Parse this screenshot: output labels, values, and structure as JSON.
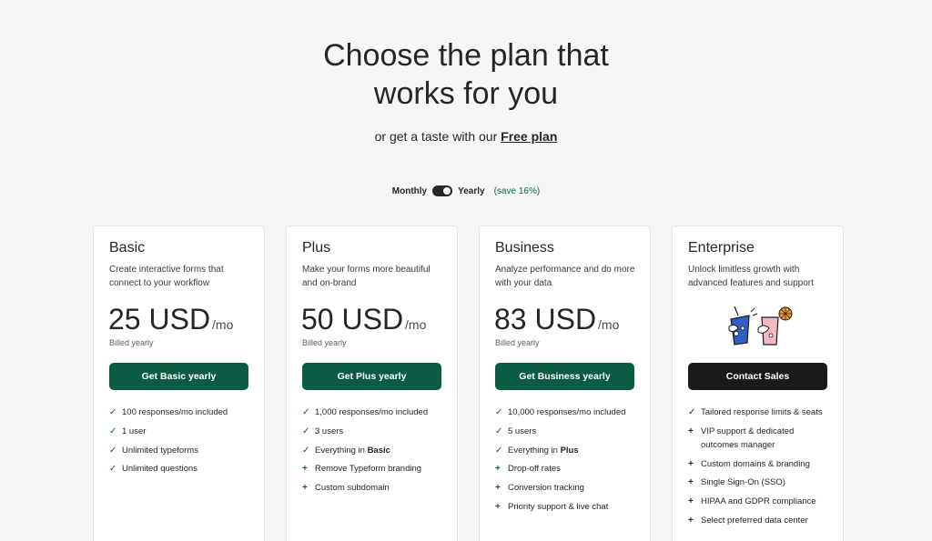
{
  "header": {
    "title_line1": "Choose the plan that",
    "title_line2": "works for you",
    "subtitle_prefix": "or get a taste with our",
    "free_plan_link": "Free plan"
  },
  "billing_toggle": {
    "monthly_label": "Monthly",
    "yearly_label": "Yearly",
    "save_note": "(save 16%)",
    "selected": "Yearly"
  },
  "plans": [
    {
      "name": "Basic",
      "description": "Create interactive forms that connect to your workflow",
      "price": "25 USD",
      "period": "/mo",
      "billed": "Billed yearly",
      "cta": "Get Basic yearly",
      "features": [
        {
          "icon": "check-icon",
          "text": "100 responses/mo included"
        },
        {
          "icon": "check-icon",
          "text": "1 user"
        },
        {
          "icon": "check-icon",
          "text": "Unlimited typeforms"
        },
        {
          "icon": "check-icon",
          "text": "Unlimited questions"
        }
      ]
    },
    {
      "name": "Plus",
      "description": "Make your forms more beautiful and on-brand",
      "price": "50 USD",
      "period": "/mo",
      "billed": "Billed yearly",
      "cta": "Get Plus yearly",
      "features": [
        {
          "icon": "check-icon",
          "text": "1,000 responses/mo included"
        },
        {
          "icon": "check-icon",
          "text": "3 users"
        },
        {
          "icon": "check-icon",
          "text_prefix": "Everything in",
          "text_bold": "Basic"
        },
        {
          "icon": "plus-icon",
          "text": "Remove Typeform branding"
        },
        {
          "icon": "plus-icon",
          "text": "Custom subdomain"
        }
      ]
    },
    {
      "name": "Business",
      "description": "Analyze performance and do more with your data",
      "price": "83 USD",
      "period": "/mo",
      "billed": "Billed yearly",
      "cta": "Get Business yearly",
      "features": [
        {
          "icon": "check-icon",
          "text": "10,000 responses/mo included"
        },
        {
          "icon": "check-icon",
          "text": "5 users"
        },
        {
          "icon": "check-icon",
          "text_prefix": "Everything in",
          "text_bold": "Plus"
        },
        {
          "icon": "plus-icon",
          "text": "Drop-off rates"
        },
        {
          "icon": "plus-icon",
          "text": "Conversion tracking"
        },
        {
          "icon": "plus-icon",
          "text": "Priority support & live chat"
        }
      ]
    },
    {
      "name": "Enterprise",
      "description": "Unlock limitless growth with advanced features and support",
      "cta": "Contact Sales",
      "features": [
        {
          "icon": "check-icon",
          "text": "Tailored response limits & seats"
        },
        {
          "icon": "plus-icon",
          "text": "VIP support & dedicated outcomes manager"
        },
        {
          "icon": "plus-icon",
          "text": "Custom domains & branding"
        },
        {
          "icon": "plus-icon",
          "text": "Single Sign-On (SSO)"
        },
        {
          "icon": "plus-icon",
          "text": "HIPAA and GDPR compliance"
        },
        {
          "icon": "plus-icon",
          "text": "Select preferred data center"
        }
      ]
    }
  ],
  "colors": {
    "background": "#f6f6f6",
    "brand_green": "#0b5c44",
    "dark_button": "#1a1a1a",
    "save_green": "#0b6b4c"
  }
}
